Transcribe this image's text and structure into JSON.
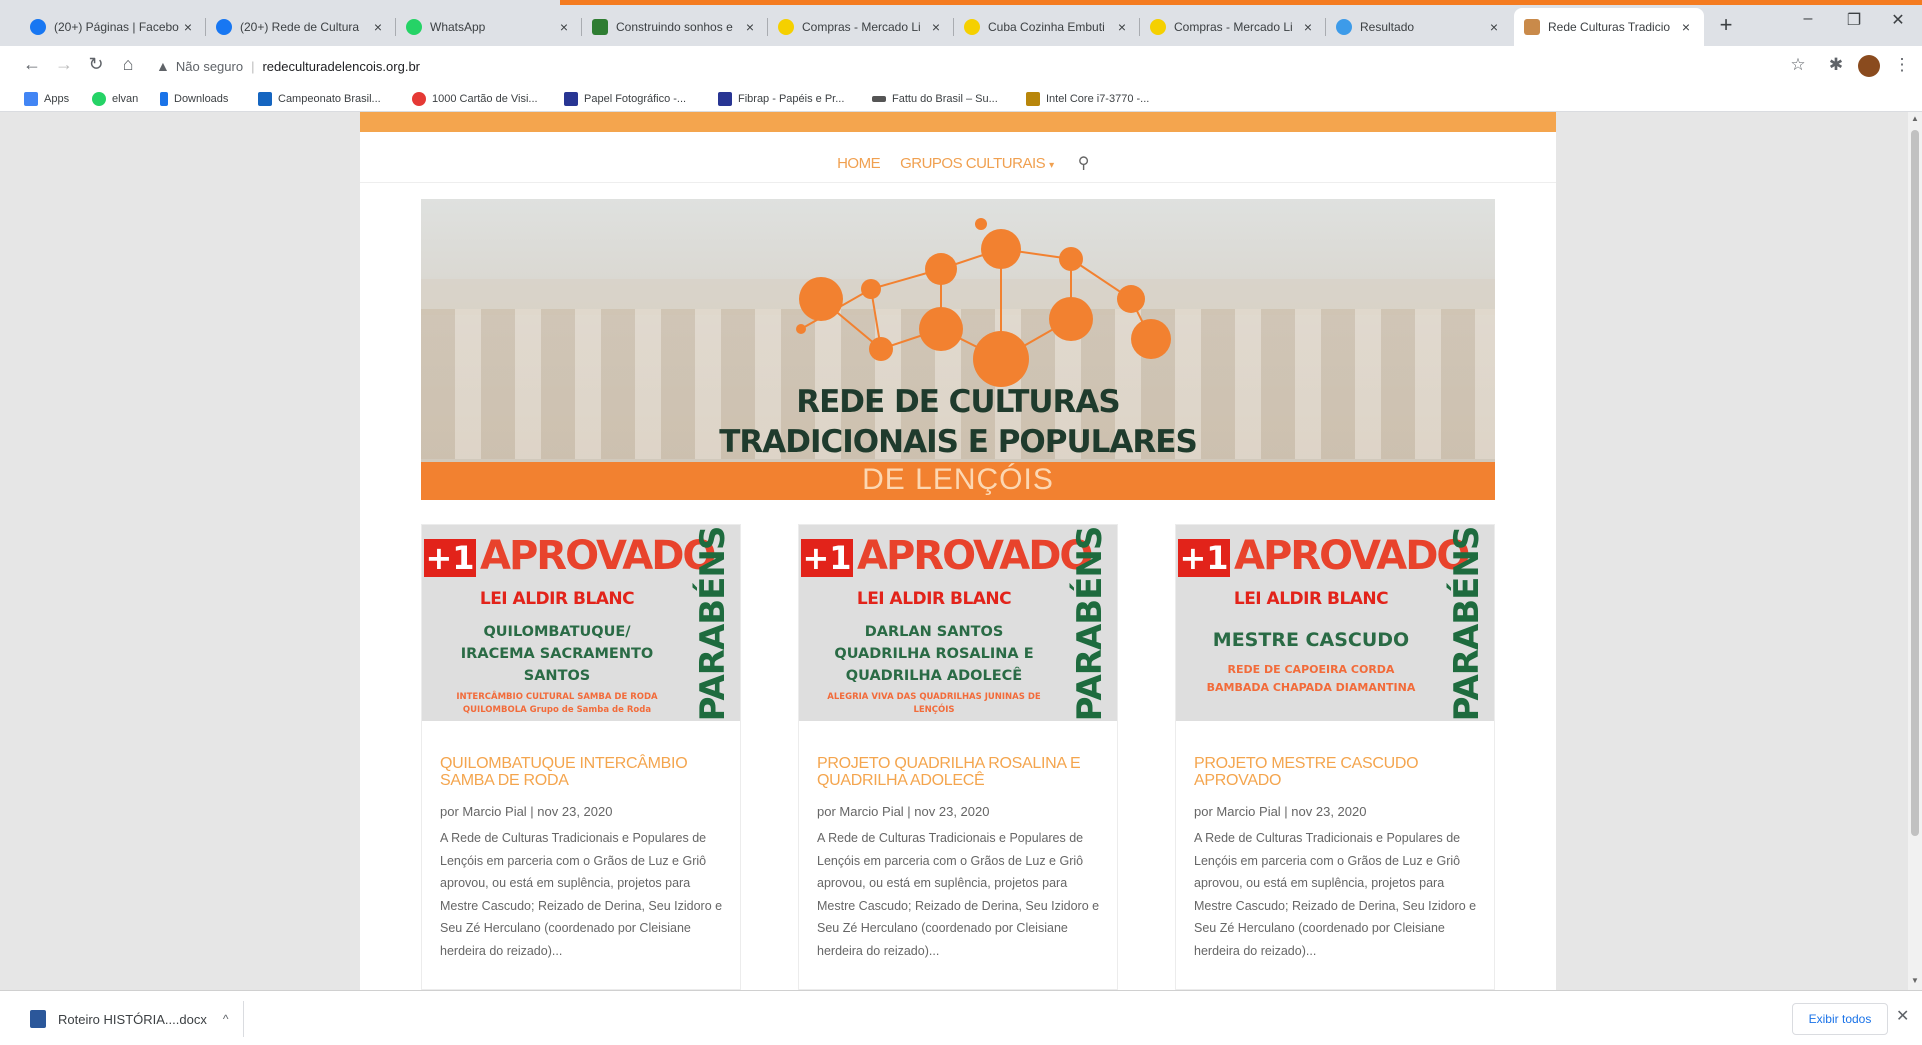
{
  "tabs": [
    {
      "title": "(20+) Páginas | Facebo",
      "color": "#1877f2"
    },
    {
      "title": "(20+) Rede de Cultura",
      "color": "#1877f2"
    },
    {
      "title": "WhatsApp",
      "color": "#25d366"
    },
    {
      "title": "Construindo sonhos e",
      "color": "#2e7d32"
    },
    {
      "title": "Compras - Mercado Li",
      "color": "#f5d000"
    },
    {
      "title": "Cuba Cozinha Embuti",
      "color": "#f5d000"
    },
    {
      "title": "Compras - Mercado Li",
      "color": "#f5d000"
    },
    {
      "title": "Resultado",
      "color": "#3d9be9"
    },
    {
      "title": "Rede Culturas Tradicio",
      "color": "#c98a4a"
    }
  ],
  "omnibox": {
    "security": "Não seguro",
    "url": "redeculturadelencois.org.br"
  },
  "bookmarks": [
    {
      "label": "Apps",
      "color": "#4285f4"
    },
    {
      "label": "elvan",
      "color": "#25d366"
    },
    {
      "label": "Downloads",
      "color": "#1a73e8"
    },
    {
      "label": "Campeonato Brasil...",
      "color": "#1565c0"
    },
    {
      "label": "1000 Cartão de Visi...",
      "color": "#e53935"
    },
    {
      "label": "Papel Fotográfico -...",
      "color": "#283593"
    },
    {
      "label": "Fibrap - Papéis e Pr...",
      "color": "#283593"
    },
    {
      "label": "Fattu do Brasil – Su...",
      "color": "#555555"
    },
    {
      "label": "Intel Core i7-3770 -...",
      "color": "#b8860b"
    }
  ],
  "site": {
    "menu": {
      "home": "HOME",
      "groups": "GRUPOS CULTURAIS"
    },
    "hero": {
      "line1": "REDE DE CULTURAS",
      "line2": "TRADICIONAIS E POPULARES",
      "band": "DE LENÇÓIS"
    }
  },
  "posts": [
    {
      "plus": "+1",
      "badge": "APROVADO",
      "law": "LEI ALDIR BLANC",
      "who": "QUILOMBATUQUE/ IRACEMA SACRAMENTO SANTOS",
      "sub": "INTERCÂMBIO CULTURAL SAMBA DE RODA QUILOMBOLA Grupo de Samba de Roda",
      "side": "PARABÉNS",
      "title": "QUILOMBATUQUE INTERCÂMBIO SAMBA DE RODA",
      "meta": "por Marcio Pial | nov 23, 2020",
      "excerpt": "A Rede de Culturas Tradicionais e Populares de Lençóis em parceria com o Grãos de Luz e Griô aprovou, ou está em suplência, projetos para Mestre Cascudo; Reizado de Derina, Seu Izidoro e Seu Zé Herculano (coordenado por Cleisiane herdeira do reizado)..."
    },
    {
      "plus": "+1",
      "badge": "APROVADO",
      "law": "LEI ALDIR BLANC",
      "who": "DARLAN SANTOS QUADRILHA ROSALINA E QUADRILHA ADOLECÊ",
      "sub": "ALEGRIA VIVA DAS QUADRILHAS JUNINAS DE LENÇÓIS",
      "side": "PARABÉNS",
      "title": "PROJETO QUADRILHA ROSALINA E QUADRILHA ADOLECÊ",
      "meta": "por Marcio Pial | nov 23, 2020",
      "excerpt": "A Rede de Culturas Tradicionais e Populares de Lençóis em parceria com o Grãos de Luz e Griô aprovou, ou está em suplência, projetos para Mestre Cascudo; Reizado de Derina, Seu Izidoro e Seu Zé Herculano (coordenado por Cleisiane herdeira do reizado)..."
    },
    {
      "plus": "+1",
      "badge": "APROVADO",
      "law": "LEI ALDIR BLANC",
      "who": "MESTRE CASCUDO",
      "sub": "REDE DE CAPOEIRA CORDA BAMBADA CHAPADA DIAMANTINA",
      "side": "PARABÉNS",
      "title": "PROJETO MESTRE CASCUDO APROVADO",
      "meta": "por Marcio Pial | nov 23, 2020",
      "excerpt": "A Rede de Culturas Tradicionais e Populares de Lençóis em parceria com o Grãos de Luz e Griô aprovou, ou está em suplência, projetos para Mestre Cascudo; Reizado de Derina, Seu Izidoro e Seu Zé Herculano (coordenado por Cleisiane herdeira do reizado)..."
    }
  ],
  "download": {
    "filename": "Roteiro HISTÓRIA....docx",
    "show_all": "Exibir todos"
  },
  "colors": {
    "accent": "#f4a54e",
    "hero_band": "#f28130",
    "badge_red": "#e8432c",
    "green": "#1e6b3e"
  }
}
